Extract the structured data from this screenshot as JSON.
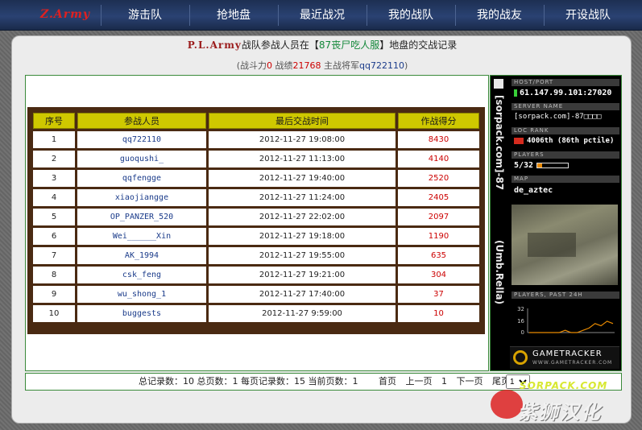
{
  "nav": {
    "logo": "Z.Army",
    "items": [
      "游击队",
      "抢地盘",
      "最近战况",
      "我的战队",
      "我的战友",
      "开设战队"
    ]
  },
  "title": {
    "army": "P.L.Army",
    "before_map": "战队参战人员在【",
    "map": "87丧尸吃人服",
    "after_map": "】地盘的交战记录"
  },
  "subtitle": {
    "power_label": "战斗力",
    "power": "0",
    "score_label": "战绩",
    "score": "21768",
    "general_label": "主战将军",
    "general": "qq722110"
  },
  "table": {
    "headers": [
      "序号",
      "参战人员",
      "最后交战时间",
      "作战得分"
    ],
    "rows": [
      {
        "no": "1",
        "name": "qq722110",
        "time": "2012-11-27 19:08:00",
        "score": "8430"
      },
      {
        "no": "2",
        "name": "guoqushi_",
        "time": "2012-11-27 11:13:00",
        "score": "4140"
      },
      {
        "no": "3",
        "name": "qqfengge",
        "time": "2012-11-27 19:40:00",
        "score": "2520"
      },
      {
        "no": "4",
        "name": "xiaojiangge",
        "time": "2012-11-27 11:24:00",
        "score": "2405"
      },
      {
        "no": "5",
        "name": "OP_PANZER_520",
        "time": "2012-11-27 22:02:00",
        "score": "2097"
      },
      {
        "no": "6",
        "name": "Wei______Xin",
        "time": "2012-11-27 19:18:00",
        "score": "1190"
      },
      {
        "no": "7",
        "name": "AK_1994",
        "time": "2012-11-27 19:55:00",
        "score": "635"
      },
      {
        "no": "8",
        "name": "csk_feng",
        "time": "2012-11-27 19:21:00",
        "score": "304"
      },
      {
        "no": "9",
        "name": "wu_shong_1",
        "time": "2012-11-27 17:40:00",
        "score": "37"
      },
      {
        "no": "10",
        "name": "buggests",
        "time": "2012-11-27 9:59:00",
        "score": "10"
      }
    ]
  },
  "tracker": {
    "vertical_title_1": "[sorpack.com]-87",
    "vertical_title_2": "(Umb.Rella)",
    "host_label": "HOST/PORT",
    "host": "61.147.99.101:27020",
    "server_label": "SERVER NAME",
    "server": "[sorpack.com]-87□□□□",
    "rank_label": "LOC  RANK",
    "rank": "4006th (86th pctile)",
    "players_label": "PLAYERS",
    "players": "5/32",
    "players_fill": 0.16,
    "map_label": "MAP",
    "map": "de_aztec",
    "past_label": "PLAYERS, PAST 24H",
    "chart_ticks": [
      "32",
      "16",
      "0"
    ],
    "chart_values": [
      0,
      0,
      0,
      0,
      0,
      0,
      1,
      0,
      0,
      1,
      2,
      4,
      3,
      5,
      4
    ],
    "brand": "GAMETRACKER",
    "brand_url": "WWW.GAMETRACKER.COM"
  },
  "footer": {
    "total_records_label": "总记录数：",
    "total_records": "10",
    "total_pages_label": "总页数：",
    "total_pages": "1",
    "per_page_label": "每页记录数：",
    "per_page": "15",
    "current_page_label": "当前页数：",
    "current_page": "1",
    "first": "首页",
    "prev": "上一页",
    "page_num": "1",
    "next": "下一页",
    "last": "尾页",
    "select_value": "1"
  },
  "watermark": {
    "line1": "SORPACK.COM",
    "line2": "紫狮汉化"
  },
  "colors": {
    "nav_bg": "#2a4272",
    "header_cell": "#cfc800",
    "table_frame": "#4a2a12",
    "score_red": "#cc0000",
    "name_blue": "#1a3b8a"
  }
}
